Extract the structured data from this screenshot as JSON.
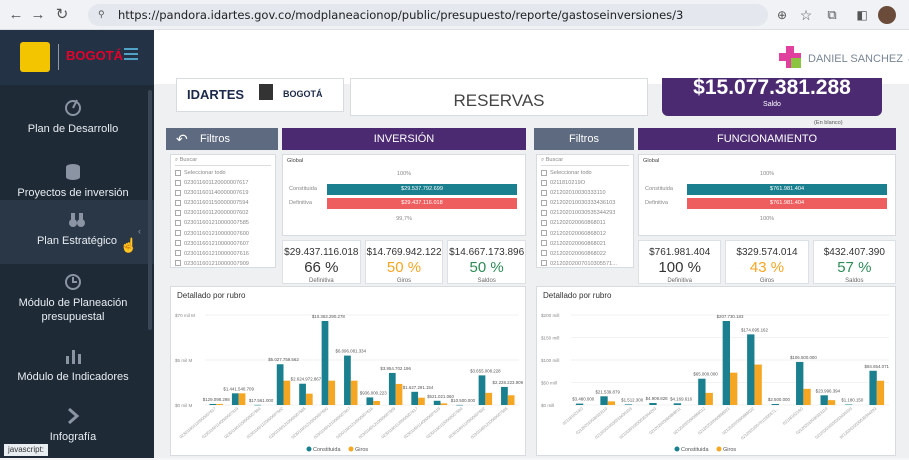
{
  "browser": {
    "url": "https://pandora.idartes.gov.co/modplaneacionop/public/presupuesto/reporte/gastoseinversiones/3",
    "status_text": "javascript:"
  },
  "sidebar": {
    "brand": "BOGOTÁ",
    "items": [
      {
        "label": "Plan de Desarrollo",
        "icon": "target-icon"
      },
      {
        "label": "Proyectos de inversión",
        "icon": "database-icon"
      },
      {
        "label": "Plan Estratégico",
        "icon": "binoculars-icon"
      },
      {
        "label": "Módulo de Planeación presupuestal",
        "icon": "clock-icon"
      },
      {
        "label": "Módulo de Indicadores",
        "icon": "bar-chart-icon"
      },
      {
        "label": "Infografía",
        "icon": "arrow-right-icon"
      }
    ]
  },
  "topbar": {
    "user": "DANIEL SANCHEZ"
  },
  "report": {
    "logo_idartes": "IDARTES",
    "logo_bogota": "BOGOTÁ",
    "title": "RESERVAS",
    "total_value": "$15.077.381.288",
    "total_label": "Saldo",
    "blank_note": "(En blanco)",
    "filters_label": "Filtros",
    "inversion": {
      "header": "INVERSIÓN",
      "search": "Buscar",
      "select_all": "Seleccionar todo",
      "items": [
        "023011601120000007617",
        "023011601140000007619",
        "023011601150000007594",
        "023011601120000007602",
        "023011601210000007585",
        "023011601210000007600",
        "023011601210000007607",
        "023011601210000007616",
        "023011601210000007909"
      ],
      "global_label": "Global",
      "pct_top": "100%",
      "const_label": "Constituida",
      "def_label": "Definitiva",
      "const_value": "$29.537.792.699",
      "def_value": "$29.437.116.018",
      "pct_bottom": "99,7%",
      "kpis": [
        {
          "value": "$29.437.116.018",
          "pct": "66 %",
          "label": "Definitiva",
          "color": "#333333"
        },
        {
          "value": "$14.769.942.122",
          "pct": "50 %",
          "label": "Giros",
          "color": "#f5a623"
        },
        {
          "value": "$14.667.173.896",
          "pct": "50 %",
          "label": "Saldos",
          "color": "#2e8b57"
        }
      ],
      "chart_title": "Detallado por rubro",
      "y_ticks": [
        "$70 mil M",
        "$5 mil M",
        "$0 mil M"
      ],
      "bars": [
        {
          "label": "$129.098.298",
          "c": 129098298,
          "g": 129098298
        },
        {
          "label": "$1.441.540.709",
          "c": 1441540709,
          "g": 1441540709
        },
        {
          "label": "$17.561.000",
          "c": 17561000,
          "g": 0
        },
        {
          "label": "$5.027.759.562",
          "c": 5027759562,
          "g": 3000000000
        },
        {
          "label": "$2.624.972.867",
          "c": 2624972867,
          "g": 1400000000
        },
        {
          "label": "$10.363.290.278",
          "c": 10363290278,
          "g": 3000000000
        },
        {
          "label": "$6.096.081.334",
          "c": 6096081334,
          "g": 3000000000
        },
        {
          "label": "$936.000.223",
          "c": 936000223,
          "g": 500000000
        },
        {
          "label": "$3.954.702.196",
          "c": 3954702196,
          "g": 2600000000
        },
        {
          "label": "$1.627.291.154",
          "c": 1627291154,
          "g": 900000000
        },
        {
          "label": "$521.021.060",
          "c": 521021060,
          "g": 200000000
        },
        {
          "label": "$10.500.000",
          "c": 10500000,
          "g": 0
        },
        {
          "label": "$3.655.008.228",
          "c": 3655008228,
          "g": 1500000000
        },
        {
          "label": "$2.228.223.909",
          "c": 2228223909,
          "g": 1200000000
        }
      ]
    },
    "funcionamiento": {
      "header": "FUNCIONAMIENTO",
      "search": "Buscar",
      "select_all": "Seleccionar todo",
      "items": [
        "0211810219O",
        "021202010030333110",
        "021202010030333436103",
        "021202010030535344293",
        "021202020060868011",
        "021202020060868012",
        "021202020060868021",
        "021202020060868022",
        "02120202007010305571..."
      ],
      "global_label": "Global",
      "pct_top": "100%",
      "const_label": "Constituida",
      "def_label": "Definitiva",
      "const_value": "$761.981.404",
      "def_value": "$761.981.404",
      "pct_bottom": "100%",
      "kpis": [
        {
          "value": "$761.981.404",
          "pct": "100 %",
          "label": "Definitiva",
          "color": "#333333"
        },
        {
          "value": "$329.574.014",
          "pct": "43 %",
          "label": "Giros",
          "color": "#f5a623"
        },
        {
          "value": "$432.407.390",
          "pct": "57 %",
          "label": "Saldos",
          "color": "#2e8b57"
        }
      ],
      "chart_title": "Detallado por rubro",
      "y_ticks": [
        "$200 mill",
        "$150 mill",
        "$100 mill",
        "$50 mill",
        "$0 mill"
      ],
      "bars": [
        {
          "label": "$3.480.000",
          "c": 3480000,
          "g": 0
        },
        {
          "label": "$21.539.879",
          "c": 21539879,
          "g": 9000000
        },
        {
          "label": "$1.512.300",
          "c": 1512300,
          "g": 0
        },
        {
          "label": "$4.909.828",
          "c": 4909828,
          "g": 0
        },
        {
          "label": "$4.169.616",
          "c": 4169616,
          "g": 0
        },
        {
          "label": "$65.000.000",
          "c": 65000000,
          "g": 30000000
        },
        {
          "label": "$207.730.183",
          "c": 207730183,
          "g": 80000000
        },
        {
          "label": "$174.695.162",
          "c": 174695162,
          "g": 100000000
        },
        {
          "label": "$2.500.000",
          "c": 2500000,
          "g": 0
        },
        {
          "label": "$106.500.000",
          "c": 106500000,
          "g": 40000000
        },
        {
          "label": "$23.996.394",
          "c": 23996394,
          "g": 12000000
        },
        {
          "label": "$1.180.150",
          "c": 1180150,
          "g": 0
        },
        {
          "label": "$84.654.071",
          "c": 84654071,
          "g": 60000000
        }
      ]
    },
    "legend": {
      "constituida": "Constituida",
      "giros": "Giros"
    }
  },
  "colors": {
    "teal": "#1a7f8e",
    "orange": "#f5a623",
    "purple": "#4b2a72",
    "sidebar": "#1f2a37"
  }
}
